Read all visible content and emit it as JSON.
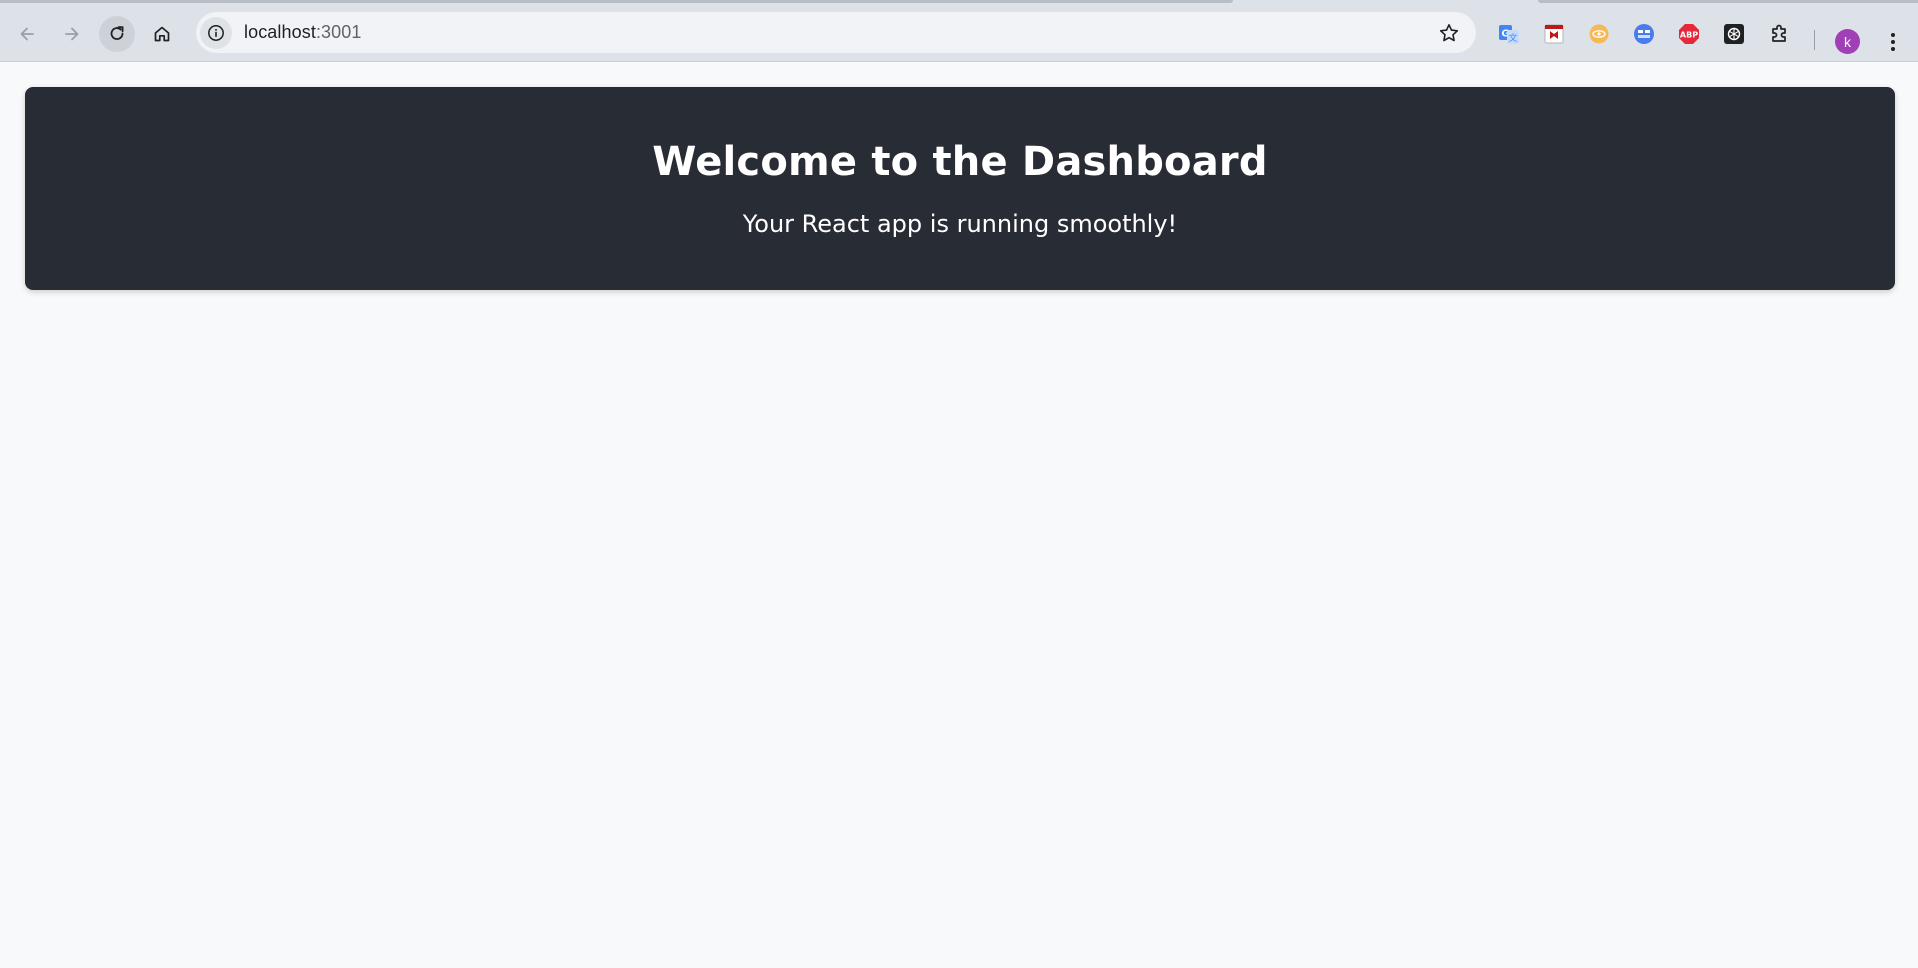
{
  "browser": {
    "url_host": "localhost",
    "url_port": ":3001",
    "extensions": [
      {
        "name": "google-translate-icon",
        "color": "#4285f4"
      },
      {
        "name": "mcafee-icon",
        "color": "#c01818"
      },
      {
        "name": "honey-extension-icon",
        "color": "#f5a623"
      },
      {
        "name": "extension-blue-icon",
        "color": "#3b82f6"
      },
      {
        "name": "adblock-plus-icon",
        "color": "#e7283b",
        "label": "ABP"
      },
      {
        "name": "chatgpt-icon",
        "color": "#202123"
      },
      {
        "name": "extensions-puzzle-icon",
        "color": "#202124"
      }
    ],
    "profile_initial": "k",
    "profile_color": "#a03fb6"
  },
  "page": {
    "title": "Welcome to the Dashboard",
    "subtitle": "Your React app is running smoothly!",
    "header_background": "#282c34",
    "page_background": "#f8f9fa"
  }
}
